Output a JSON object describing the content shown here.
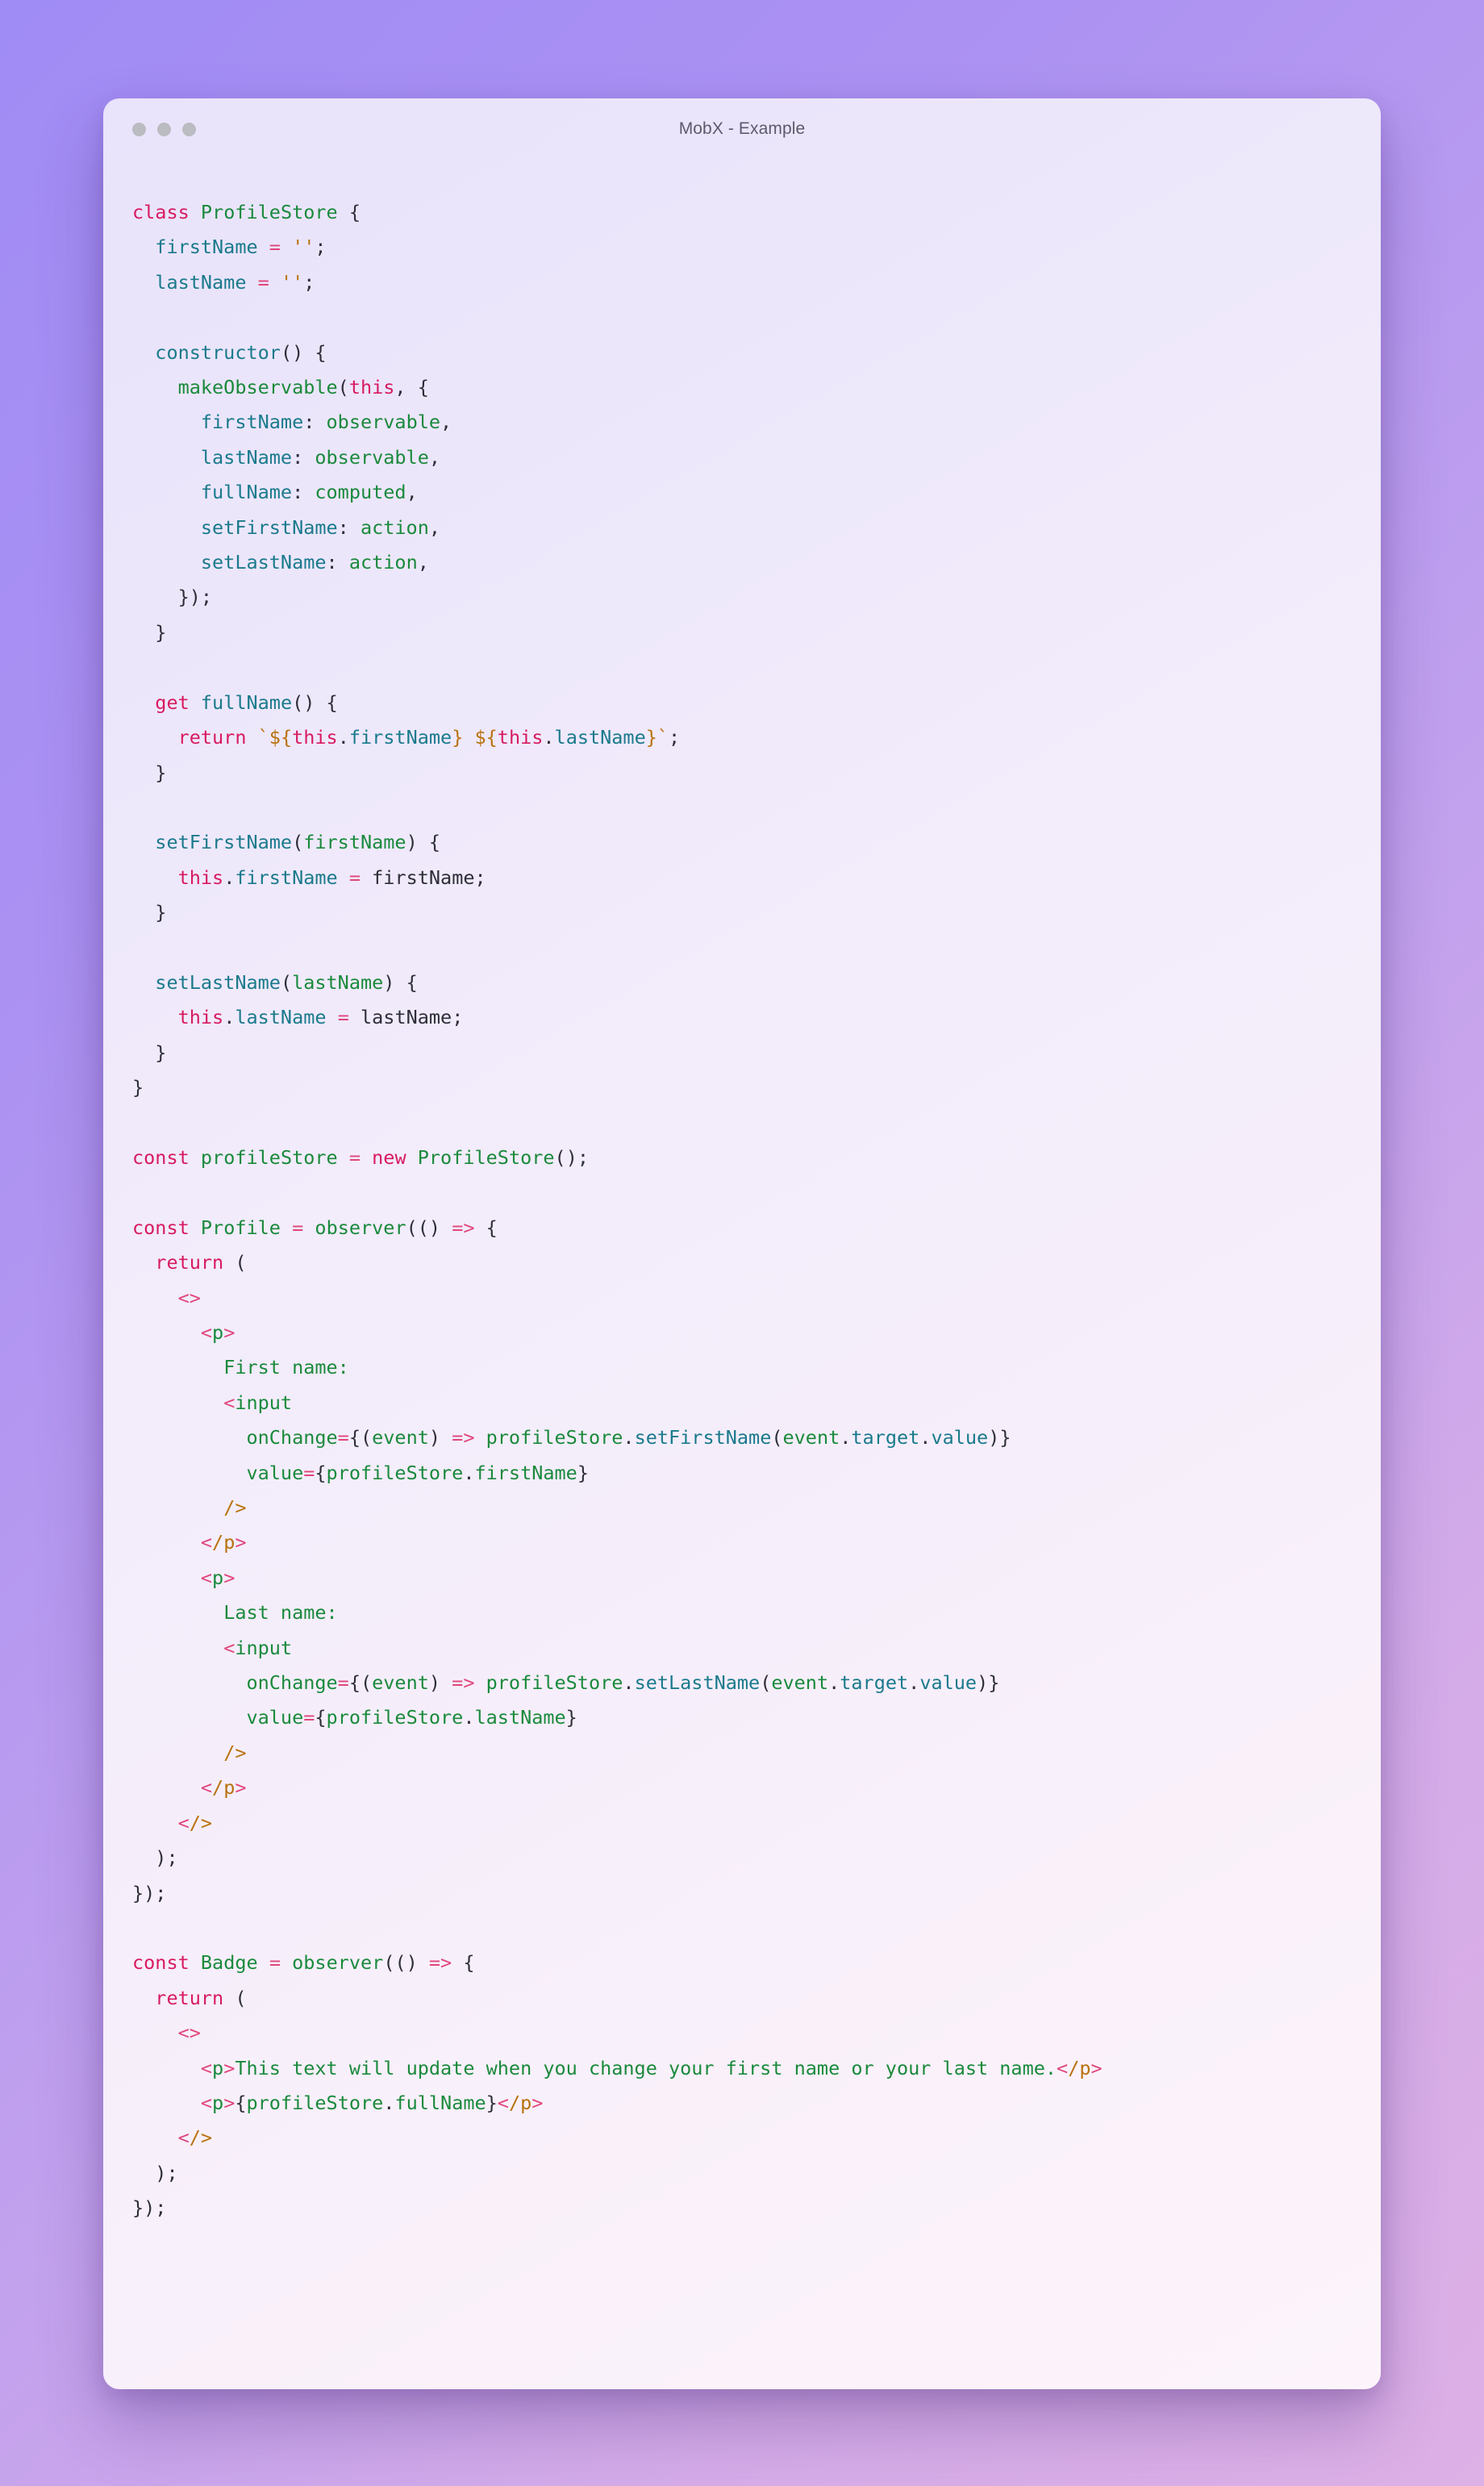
{
  "background": {
    "gradient_start": "#a08cf5",
    "gradient_end": "#ddb0e6"
  },
  "window": {
    "title": "MobX - Example",
    "traffic_lights": [
      {
        "name": "close-dot",
        "color": "#bbbbc2"
      },
      {
        "name": "minimize-dot",
        "color": "#bbbbc2"
      },
      {
        "name": "maximize-dot",
        "color": "#bbbbc2"
      }
    ],
    "surface_color": "#ece6fb"
  },
  "syntax_colors": {
    "keyword": "#d81b60",
    "identifier": "#1a8a3c",
    "property": "#1a7a8c",
    "operator": "#e0457b",
    "string": "#b8720d",
    "plain": "#2e2e38"
  },
  "code": {
    "language": "jsx",
    "lines": [
      "class ProfileStore {",
      "  firstName = '';",
      "  lastName = '';",
      "",
      "  constructor() {",
      "    makeObservable(this, {",
      "      firstName: observable,",
      "      lastName: observable,",
      "      fullName: computed,",
      "      setFirstName: action,",
      "      setLastName: action,",
      "    });",
      "  }",
      "",
      "  get fullName() {",
      "    return `${this.firstName} ${this.lastName}`;",
      "  }",
      "",
      "  setFirstName(firstName) {",
      "    this.firstName = firstName;",
      "  }",
      "",
      "  setLastName(lastName) {",
      "    this.lastName = lastName;",
      "  }",
      "}",
      "",
      "const profileStore = new ProfileStore();",
      "",
      "const Profile = observer(() => {",
      "  return (",
      "    <>",
      "      <p>",
      "        First name:",
      "        <input",
      "          onChange={(event) => profileStore.setFirstName(event.target.value)}",
      "          value={profileStore.firstName}",
      "        />",
      "      </p>",
      "      <p>",
      "        Last name:",
      "        <input",
      "          onChange={(event) => profileStore.setLastName(event.target.value)}",
      "          value={profileStore.lastName}",
      "        />",
      "      </p>",
      "    </>",
      "  );",
      "});",
      "",
      "const Badge = observer(() => {",
      "  return (",
      "    <>",
      "      <p>This text will update when you change your first name or your last name.</p>",
      "      <p>{profileStore.fullName}</p>",
      "    </>",
      "  );",
      "});"
    ]
  }
}
